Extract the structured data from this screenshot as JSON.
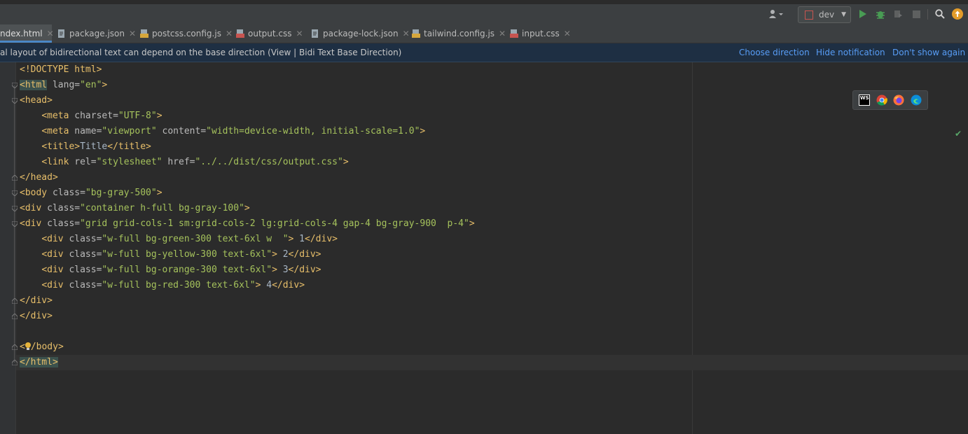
{
  "toolbar": {
    "run_config": "dev",
    "icons": [
      "user-icon",
      "run-icon",
      "debug-icon",
      "coverage-icon",
      "stop-icon",
      "search-icon",
      "update-icon"
    ]
  },
  "tabs": [
    {
      "label": "ndex.html",
      "type": "html",
      "active": true
    },
    {
      "label": "package.json",
      "type": "json",
      "active": false
    },
    {
      "label": "postcss.config.js",
      "type": "js",
      "active": false
    },
    {
      "label": "output.css",
      "type": "css",
      "active": false
    },
    {
      "label": "package-lock.json",
      "type": "json",
      "active": false
    },
    {
      "label": "tailwind.config.js",
      "type": "js",
      "active": false
    },
    {
      "label": "input.css",
      "type": "css",
      "active": false
    }
  ],
  "notification": {
    "message": "al layout of bidirectional text can depend on the base direction (View | Bidi Text Base Direction)",
    "actions": [
      "Choose direction",
      "Hide notification",
      "Don't show again"
    ]
  },
  "browser_icons": [
    "WS",
    "chrome",
    "firefox",
    "edge"
  ],
  "code": {
    "l1": [
      "<!DOCTYPE html>"
    ],
    "l2": [
      "<html",
      " lang=",
      "\"en\"",
      ">"
    ],
    "l3": [
      "<head>"
    ],
    "l4": [
      "    ",
      "<meta",
      " charset=",
      "\"UTF-8\"",
      ">"
    ],
    "l5": [
      "    ",
      "<meta",
      " name=",
      "\"viewport\"",
      " content=",
      "\"width=device-width, initial-scale=1.0\"",
      ">"
    ],
    "l6": [
      "    ",
      "<title>",
      "Title",
      "</title>"
    ],
    "l7": [
      "    ",
      "<link",
      " rel=",
      "\"stylesheet\"",
      " href=",
      "\"../../dist/css/output.css\"",
      ">"
    ],
    "l8": [
      "</head>"
    ],
    "l9": [
      "<body",
      " class=",
      "\"bg-gray-500\"",
      ">"
    ],
    "l10": [
      "<div",
      " class=",
      "\"container h-full bg-gray-100\"",
      ">"
    ],
    "l11": [
      "<div",
      " class=",
      "\"grid grid-cols-1 sm:grid-cols-2 lg:grid-cols-4 gap-4 bg-gray-900  p-4\"",
      ">"
    ],
    "l12": [
      "    ",
      "<div",
      " class=",
      "\"w-full bg-green-300 text-6xl w  \"",
      ">",
      " 1",
      "</div>"
    ],
    "l13": [
      "    ",
      "<div",
      " class=",
      "\"w-full bg-yellow-300 text-6xl\"",
      ">",
      " 2",
      "</div>"
    ],
    "l14": [
      "    ",
      "<div",
      " class=",
      "\"w-full bg-orange-300 text-6xl\"",
      ">",
      " 3",
      "</div>"
    ],
    "l15": [
      "    ",
      "<div",
      " class=",
      "\"w-full bg-red-300 text-6xl\"",
      ">",
      " 4",
      "</div>"
    ],
    "l16": [
      "</div>"
    ],
    "l17": [
      "</div>"
    ],
    "l18": [
      ""
    ],
    "l19": [
      "<",
      "/body>"
    ],
    "l20": [
      "</html>"
    ]
  }
}
